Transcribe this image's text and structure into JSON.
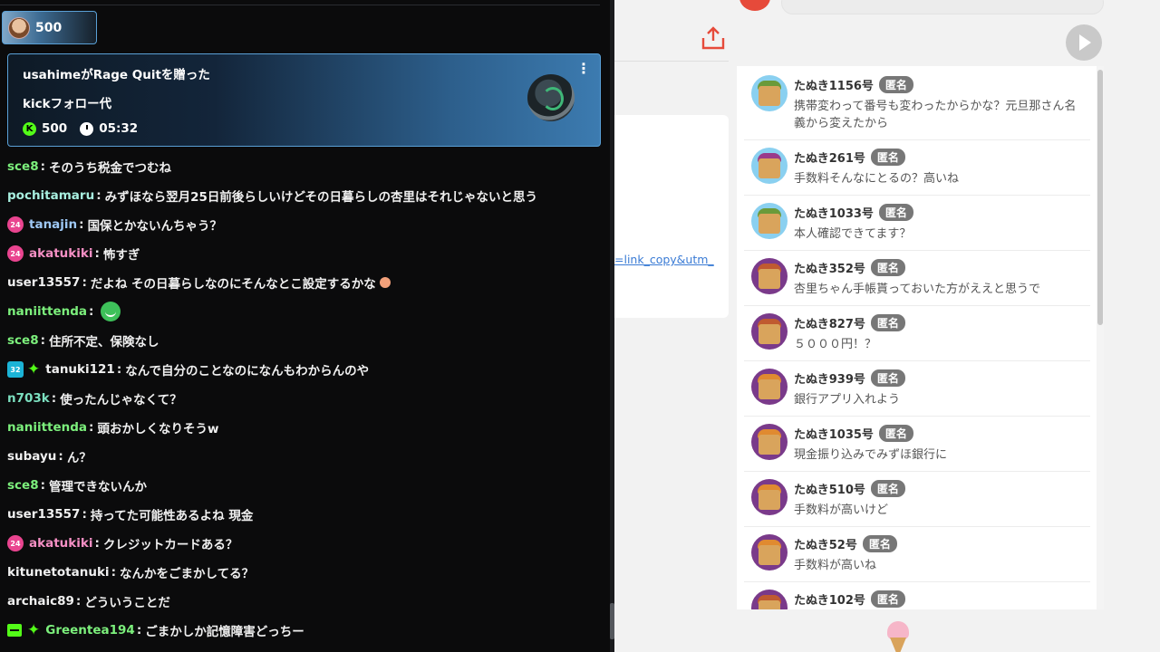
{
  "kick": {
    "pill_count": "500",
    "gift": {
      "line1": "usahimeがRage Quitを贈った",
      "line2": "kickフォロー代",
      "amount": "500",
      "time": "05:32",
      "coin_symbol": "K"
    },
    "messages": [
      {
        "user": "sce8",
        "text": "そのうち税金でつむね",
        "color": "#7cf07c",
        "badges": []
      },
      {
        "user": "pochitamaru",
        "text": "みずほなら翌月25日前後らしいけどその日暮らしの杏里はそれじゃないと思う",
        "color": "#a8f0e0",
        "badges": []
      },
      {
        "user": "tanajin",
        "text": "国保とかないんちゃう？",
        "color": "#9ec8f5",
        "badges": [
          "24"
        ]
      },
      {
        "user": "akatukiki",
        "text": "怖すぎ",
        "color": "#f58fc4",
        "badges": [
          "24"
        ]
      },
      {
        "user": "user13557",
        "text": "だよね その日暮らしなのにそんなとこ設定するかな",
        "color": "#f0f0f0",
        "badges": [],
        "emote": "small"
      },
      {
        "user": "naniittenda",
        "text": "",
        "color": "#7cf07c",
        "badges": [],
        "emote": "green"
      },
      {
        "user": "sce8",
        "text": "住所不定、保険なし",
        "color": "#7cf07c",
        "badges": []
      },
      {
        "user": "tanuki121",
        "text": "なんで自分のことなのになんもわからんのや",
        "color": "#f0f0f0",
        "badges": [
          "32",
          "spark"
        ]
      },
      {
        "user": "n703k",
        "text": "使ったんじゃなくて？",
        "color": "#7ce0c0",
        "badges": []
      },
      {
        "user": "naniittenda",
        "text": "頭おかしくなりそうw",
        "color": "#7cf07c",
        "badges": []
      },
      {
        "user": "subayu",
        "text": "ん？",
        "color": "#f0f0f0",
        "badges": []
      },
      {
        "user": "sce8",
        "text": "管理できないんか",
        "color": "#7cf07c",
        "badges": []
      },
      {
        "user": "user13557",
        "text": "持ってた可能性あるよね 現金",
        "color": "#f0f0f0",
        "badges": []
      },
      {
        "user": "akatukiki",
        "text": "クレジットカードある？",
        "color": "#f58fc4",
        "badges": [
          "24"
        ]
      },
      {
        "user": "kitunetotanuki",
        "text": "なんかをごまかしてる？",
        "color": "#f0f0f0",
        "badges": []
      },
      {
        "user": "archaic89",
        "text": "どういうことだ",
        "color": "#f0f0f0",
        "badges": []
      },
      {
        "user": "Greentea194",
        "text": "ごまかしか記憶障害どっちー",
        "color": "#7cf07c",
        "badges": [
          "sub",
          "spark"
        ]
      }
    ]
  },
  "page": {
    "link_text": "=link_copy&utm_",
    "comments": [
      {
        "name": "たぬき1156号",
        "anon": "匿名",
        "text": "携帯変わって番号も変わったからかな？元旦那さん名義から変えたから",
        "avatar_bg": "#8ad0f0",
        "ears": "#6a9a3a"
      },
      {
        "name": "たぬき261号",
        "anon": "匿名",
        "text": "手数料そんなにとるの？高いね",
        "avatar_bg": "#8ad0f0",
        "ears": "#9a3a8a"
      },
      {
        "name": "たぬき1033号",
        "anon": "匿名",
        "text": "本人確認できてます？",
        "avatar_bg": "#8ad0f0",
        "ears": "#6a9a3a"
      },
      {
        "name": "たぬき352号",
        "anon": "匿名",
        "text": "杏里ちゃん手帳貰っておいた方がええと思うで",
        "avatar_bg": "#7a3a8a",
        "ears": "#c05a30"
      },
      {
        "name": "たぬき827号",
        "anon": "匿名",
        "text": "５０００円！？",
        "avatar_bg": "#7a3a8a",
        "ears": "#c05a30"
      },
      {
        "name": "たぬき939号",
        "anon": "匿名",
        "text": "銀行アプリ入れよう",
        "avatar_bg": "#7a3a8a",
        "ears": "#e08a30"
      },
      {
        "name": "たぬき1035号",
        "anon": "匿名",
        "text": "現金振り込みでみずほ銀行に",
        "avatar_bg": "#7a3a8a",
        "ears": "#e08a30"
      },
      {
        "name": "たぬき510号",
        "anon": "匿名",
        "text": "手数料が高いけど",
        "avatar_bg": "#7a3a8a",
        "ears": "#e08a30"
      },
      {
        "name": "たぬき52号",
        "anon": "匿名",
        "text": "手数料が高いね",
        "avatar_bg": "#7a3a8a",
        "ears": "#e08a30"
      },
      {
        "name": "たぬき102号",
        "anon": "匿名",
        "text": "",
        "avatar_bg": "#7a3a8a",
        "ears": "#c05a30"
      }
    ]
  }
}
